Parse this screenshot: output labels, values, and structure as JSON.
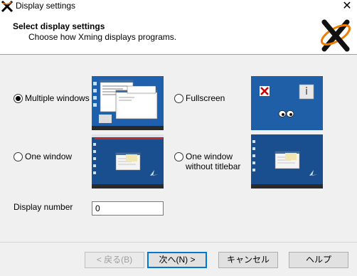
{
  "window": {
    "title": "Display settings"
  },
  "header": {
    "title": "Select display settings",
    "subtitle": "Choose how Xming displays programs."
  },
  "options": [
    {
      "label": "Multiple windows",
      "selected": true
    },
    {
      "label": "Fullscreen",
      "selected": false
    },
    {
      "label": "One window",
      "selected": false
    },
    {
      "label": "One window\nwithout titlebar",
      "selected": false
    }
  ],
  "display_number": {
    "label": "Display number",
    "value": "0"
  },
  "buttons": {
    "back": "< 戻る(B)",
    "next": "次へ(N) >",
    "cancel": "キャンセル",
    "help": "ヘルプ"
  },
  "colors": {
    "desktop_blue": "#1f5fa8",
    "accent": "#0078d7",
    "logo_orange": "#f07c00"
  }
}
